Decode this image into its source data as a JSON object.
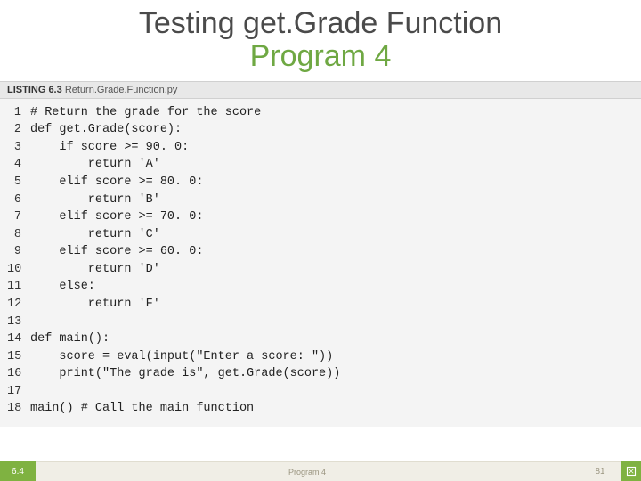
{
  "title": {
    "line1": "Testing get.Grade Function",
    "line2": "Program 4"
  },
  "listing": {
    "prefix": "LISTING 6.3",
    "filename": "Return.Grade.Function.py"
  },
  "code": {
    "lines": [
      {
        "n": "1",
        "t": "# Return the grade for the score"
      },
      {
        "n": "2",
        "t": "def get.Grade(score):"
      },
      {
        "n": "3",
        "t": "    if score >= 90. 0:"
      },
      {
        "n": "4",
        "t": "        return 'A'"
      },
      {
        "n": "5",
        "t": "    elif score >= 80. 0:"
      },
      {
        "n": "6",
        "t": "        return 'B'"
      },
      {
        "n": "7",
        "t": "    elif score >= 70. 0:"
      },
      {
        "n": "8",
        "t": "        return 'C'"
      },
      {
        "n": "9",
        "t": "    elif score >= 60. 0:"
      },
      {
        "n": "10",
        "t": "        return 'D'"
      },
      {
        "n": "11",
        "t": "    else:"
      },
      {
        "n": "12",
        "t": "        return 'F'"
      },
      {
        "n": "13",
        "t": ""
      },
      {
        "n": "14",
        "t": "def main():"
      },
      {
        "n": "15",
        "t": "    score = eval(input(\"Enter a score: \"))"
      },
      {
        "n": "16",
        "t": "    print(\"The grade is\", get.Grade(score))"
      },
      {
        "n": "17",
        "t": ""
      },
      {
        "n": "18",
        "t": "main() # Call the main function"
      }
    ]
  },
  "footer": {
    "section": "6.4",
    "center": "Program 4",
    "page": "81"
  }
}
